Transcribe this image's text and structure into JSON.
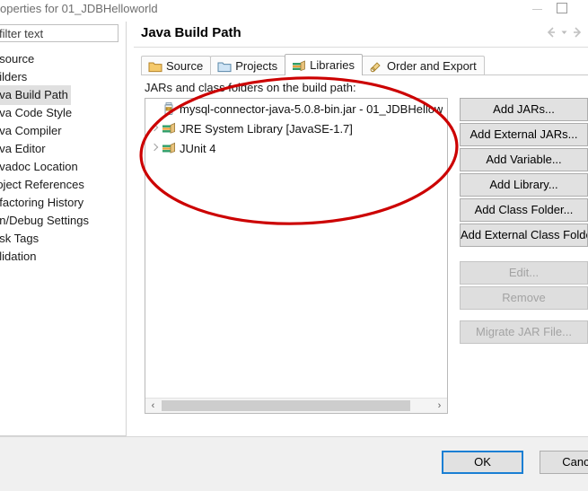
{
  "window": {
    "title": "operties for 01_JDBHelloworld",
    "minimize_icon": "minimize-icon",
    "maximize_icon": "maximize-icon"
  },
  "sidebar": {
    "filter": {
      "value": "filter text",
      "placeholder": "type filter text"
    },
    "items": [
      {
        "label": "esource",
        "selected": false
      },
      {
        "label": "uilders",
        "selected": false
      },
      {
        "label": "ava Build Path",
        "selected": true
      },
      {
        "label": "ava Code Style",
        "selected": false
      },
      {
        "label": "ava Compiler",
        "selected": false
      },
      {
        "label": "ava Editor",
        "selected": false
      },
      {
        "label": "avadoc Location",
        "selected": false
      },
      {
        "label": "roject References",
        "selected": false
      },
      {
        "label": "efactoring History",
        "selected": false
      },
      {
        "label": "un/Debug Settings",
        "selected": false
      },
      {
        "label": "ask Tags",
        "selected": false
      },
      {
        "label": "alidation",
        "selected": false
      }
    ]
  },
  "page": {
    "title": "Java Build Path",
    "nav_back_icon": "navigate-back-icon",
    "nav_history_icon": "history-dropdown-icon",
    "nav_forward_icon": "navigate-forward-icon"
  },
  "tabs": [
    {
      "label": "Source",
      "icon": "source-folder-icon",
      "active": false
    },
    {
      "label": "Projects",
      "icon": "projects-folder-icon",
      "active": false
    },
    {
      "label": "Libraries",
      "icon": "libraries-books-icon",
      "active": true
    },
    {
      "label": "Order and Export",
      "icon": "order-export-icon",
      "active": false
    }
  ],
  "libraries": {
    "list_label": "JARs and class folders on the build path:",
    "entries": [
      {
        "label": "mysql-connector-java-5.0.8-bin.jar - 01_JDBHellow",
        "icon": "jar-file-icon",
        "expandable": false
      },
      {
        "label": "JRE System Library [JavaSE-1.7]",
        "icon": "library-books-icon",
        "expandable": true
      },
      {
        "label": "JUnit 4",
        "icon": "library-books-icon",
        "expandable": true
      }
    ],
    "scrollbar": {
      "left_arrow": "‹",
      "right_arrow": "›"
    }
  },
  "buttons": [
    {
      "label": "Add JARs...",
      "enabled": true
    },
    {
      "label": "Add External JARs...",
      "enabled": true
    },
    {
      "label": "Add Variable...",
      "enabled": true
    },
    {
      "label": "Add Library...",
      "enabled": true
    },
    {
      "label": "Add Class Folder...",
      "enabled": true
    },
    {
      "label": "Add External Class Folde",
      "enabled": true
    },
    {
      "label": "Edit...",
      "enabled": false
    },
    {
      "label": "Remove",
      "enabled": false
    },
    {
      "label": "Migrate JAR File...",
      "enabled": false
    }
  ],
  "footer": {
    "ok_label": "OK",
    "cancel_label": "Cancel"
  },
  "annotation": {
    "type": "ellipse",
    "color": "#cc0000",
    "description": "red hand-drawn ellipse around the JARs list"
  }
}
